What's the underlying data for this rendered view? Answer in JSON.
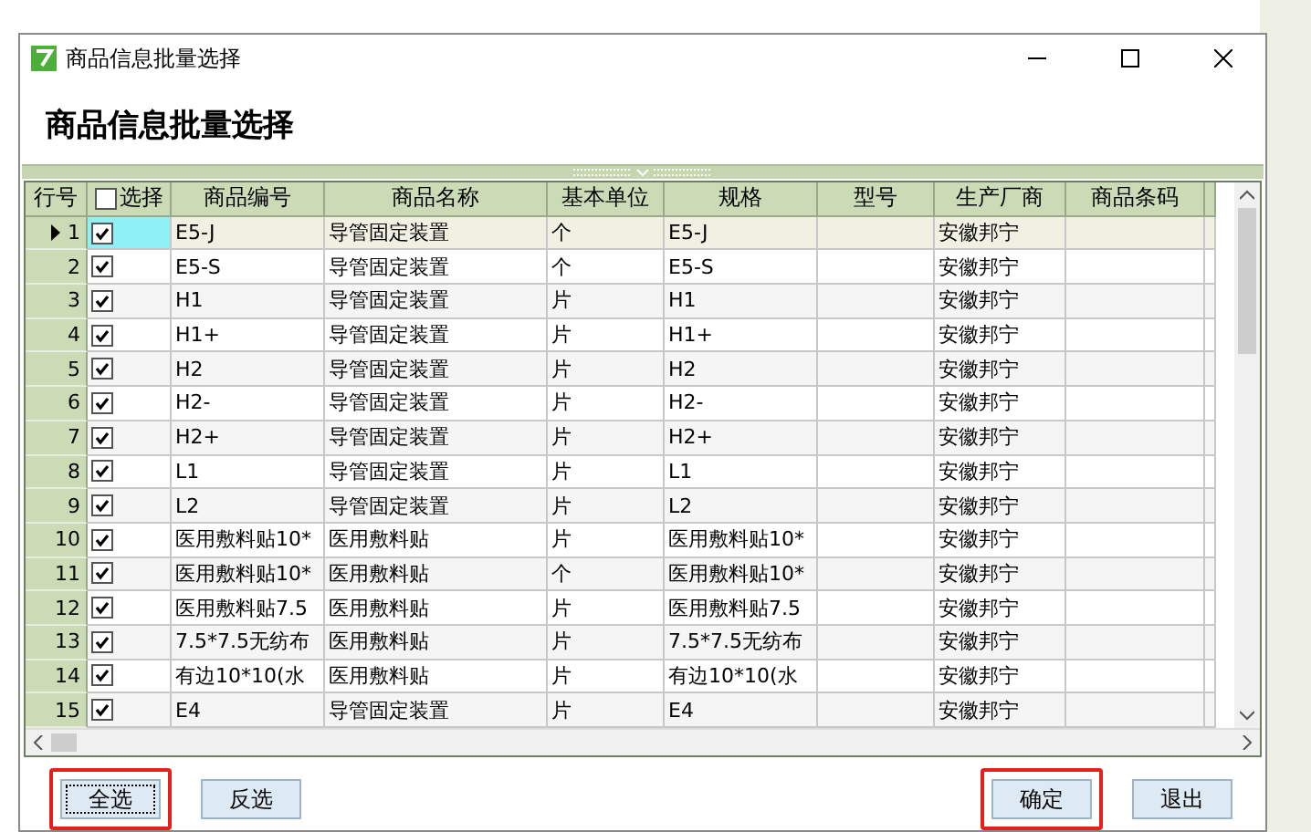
{
  "window": {
    "title": "商品信息批量选择"
  },
  "heading": "商品信息批量选择",
  "table": {
    "columns": [
      {
        "label": "行号",
        "kind": "rownum"
      },
      {
        "label": "选择",
        "kind": "check",
        "checked": false
      },
      {
        "label": "商品编号",
        "kind": "text"
      },
      {
        "label": "商品名称",
        "kind": "text"
      },
      {
        "label": "基本单位",
        "kind": "text"
      },
      {
        "label": "规格",
        "kind": "text"
      },
      {
        "label": "型号",
        "kind": "text"
      },
      {
        "label": "生产厂商",
        "kind": "text"
      },
      {
        "label": "商品条码",
        "kind": "text"
      },
      {
        "kind": "partial"
      }
    ],
    "rows": [
      {
        "selected": true,
        "checked": true,
        "cells": [
          "1",
          "",
          "E5-J",
          "导管固定装置",
          "个",
          "E5-J",
          "",
          "安徽邦宁",
          ""
        ]
      },
      {
        "selected": false,
        "checked": true,
        "cells": [
          "2",
          "",
          "E5-S",
          "导管固定装置",
          "个",
          "E5-S",
          "",
          "安徽邦宁",
          ""
        ]
      },
      {
        "selected": false,
        "checked": true,
        "cells": [
          "3",
          "",
          "H1",
          "导管固定装置",
          "片",
          "H1",
          "",
          "安徽邦宁",
          ""
        ]
      },
      {
        "selected": false,
        "checked": true,
        "cells": [
          "4",
          "",
          "H1+",
          "导管固定装置",
          "片",
          "H1+",
          "",
          "安徽邦宁",
          ""
        ]
      },
      {
        "selected": false,
        "checked": true,
        "cells": [
          "5",
          "",
          "H2",
          "导管固定装置",
          "片",
          "H2",
          "",
          "安徽邦宁",
          ""
        ]
      },
      {
        "selected": false,
        "checked": true,
        "cells": [
          "6",
          "",
          "H2-",
          "导管固定装置",
          "片",
          "H2-",
          "",
          "安徽邦宁",
          ""
        ]
      },
      {
        "selected": false,
        "checked": true,
        "cells": [
          "7",
          "",
          "H2+",
          "导管固定装置",
          "片",
          "H2+",
          "",
          "安徽邦宁",
          ""
        ]
      },
      {
        "selected": false,
        "checked": true,
        "cells": [
          "8",
          "",
          "L1",
          "导管固定装置",
          "片",
          "L1",
          "",
          "安徽邦宁",
          ""
        ]
      },
      {
        "selected": false,
        "checked": true,
        "cells": [
          "9",
          "",
          "L2",
          "导管固定装置",
          "片",
          "L2",
          "",
          "安徽邦宁",
          ""
        ]
      },
      {
        "selected": false,
        "checked": true,
        "cells": [
          "10",
          "",
          "医用敷料贴10*",
          "医用敷料贴",
          "片",
          "医用敷料贴10*",
          "",
          "安徽邦宁",
          ""
        ]
      },
      {
        "selected": false,
        "checked": true,
        "cells": [
          "11",
          "",
          "医用敷料贴10*",
          "医用敷料贴",
          "个",
          "医用敷料贴10*",
          "",
          "安徽邦宁",
          ""
        ]
      },
      {
        "selected": false,
        "checked": true,
        "cells": [
          "12",
          "",
          "医用敷料贴7.5",
          "医用敷料贴",
          "片",
          "医用敷料贴7.5",
          "",
          "安徽邦宁",
          ""
        ]
      },
      {
        "selected": false,
        "checked": true,
        "cells": [
          "13",
          "",
          "7.5*7.5无纺布",
          "医用敷料贴",
          "片",
          "7.5*7.5无纺布",
          "",
          "安徽邦宁",
          ""
        ]
      },
      {
        "selected": false,
        "checked": true,
        "cells": [
          "14",
          "",
          "有边10*10(水",
          "医用敷料贴",
          "片",
          "有边10*10(水",
          "",
          "安徽邦宁",
          ""
        ]
      },
      {
        "selected": false,
        "checked": true,
        "cells": [
          "15",
          "",
          "E4",
          "导管固定装置",
          "片",
          "E4",
          "",
          "安徽邦宁",
          ""
        ]
      }
    ]
  },
  "buttons_left": [
    {
      "label": "全选",
      "focused": true,
      "highlighted": true
    },
    {
      "label": "反选",
      "focused": false,
      "highlighted": false
    }
  ],
  "buttons_right": [
    {
      "label": "确定",
      "focused": false,
      "highlighted": true
    },
    {
      "label": "退出",
      "focused": false,
      "highlighted": false
    }
  ]
}
